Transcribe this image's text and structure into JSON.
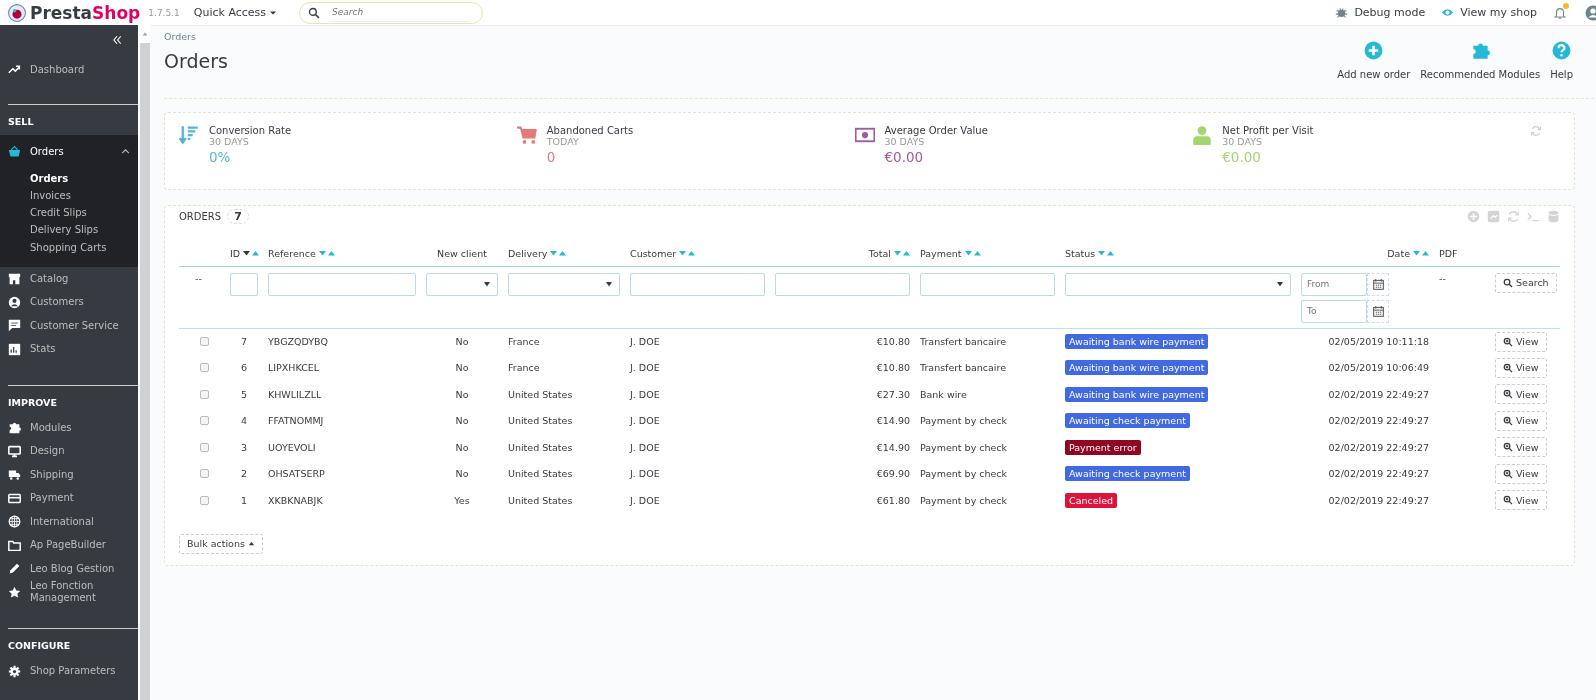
{
  "header": {
    "brand": "PrestaShop",
    "version": "1.7.5.1",
    "quick_access": "Quick Access",
    "search": {
      "placeholder": "Search"
    },
    "links": [
      {
        "label": "Debug mode"
      },
      {
        "label": "View my shop"
      }
    ],
    "notifications": {
      "unread": true
    }
  },
  "sidebar": {
    "sections": [
      {
        "items": [
          {
            "label": "Dashboard",
            "expanded": false
          }
        ]
      },
      {
        "title": "SELL",
        "items": [
          {
            "label": "Orders",
            "expanded": true,
            "children": [
              {
                "label": "Orders",
                "selected": true
              },
              {
                "label": "Invoices",
                "selected": false
              },
              {
                "label": "Credit Slips",
                "selected": false
              },
              {
                "label": "Delivery Slips",
                "selected": false
              },
              {
                "label": "Shopping Carts",
                "selected": false
              }
            ]
          },
          {
            "label": "Catalog",
            "expanded": false
          },
          {
            "label": "Customers",
            "expanded": false
          },
          {
            "label": "Customer Service",
            "expanded": false
          },
          {
            "label": "Stats",
            "expanded": false
          }
        ]
      },
      {
        "title": "IMPROVE",
        "items": [
          {
            "label": "Modules",
            "expanded": false
          },
          {
            "label": "Design",
            "expanded": false
          },
          {
            "label": "Shipping",
            "expanded": false
          },
          {
            "label": "Payment",
            "expanded": false
          },
          {
            "label": "International",
            "expanded": false
          },
          {
            "label": "Ap PageBuilder",
            "expanded": false
          },
          {
            "label": "Leo Blog Gestion",
            "expanded": false
          },
          {
            "label": "Leo Fonction Management",
            "expanded": false
          }
        ]
      },
      {
        "title": "CONFIGURE",
        "items": [
          {
            "label": "Shop Parameters",
            "expanded": false
          }
        ]
      }
    ]
  },
  "breadcrumb": "Orders",
  "title": "Orders",
  "toolbar": [
    {
      "label": "Add new order"
    },
    {
      "label": "Recommended Modules"
    },
    {
      "label": "Help"
    }
  ],
  "kpis": [
    {
      "label": "Conversion Rate",
      "period": "30 DAYS",
      "value": "0%",
      "color": "#56b3d8"
    },
    {
      "label": "Abandoned Carts",
      "period": "TODAY",
      "value": "0",
      "color": "#e27c79"
    },
    {
      "label": "Average Order Value",
      "period": "30 DAYS",
      "value": "€0.00",
      "color": "#9e5ba1"
    },
    {
      "label": "Net Profit per Visit",
      "period": "30 DAYS",
      "value": "€0.00",
      "color": "#a3d76e"
    }
  ],
  "orders": {
    "title": "ORDERS",
    "count": "7",
    "columns": [
      {
        "label": "ID",
        "sortable": true
      },
      {
        "label": "Reference",
        "sortable": true
      },
      {
        "label": "New client",
        "sortable": false
      },
      {
        "label": "Delivery",
        "sortable": true
      },
      {
        "label": "Customer",
        "sortable": true
      },
      {
        "label": "Total",
        "sortable": true
      },
      {
        "label": "Payment",
        "sortable": true
      },
      {
        "label": "Status",
        "sortable": true
      },
      {
        "label": "Date",
        "sortable": true
      },
      {
        "label": "PDF",
        "sortable": false
      }
    ],
    "filters": {
      "reset": "--",
      "pdf": "--",
      "date_from": {
        "placeholder": "From"
      },
      "date_to": {
        "placeholder": "To"
      },
      "search_button": "Search"
    },
    "rows": [
      {
        "selected": false,
        "id": "7",
        "reference": "YBGZQDYBQ",
        "new_client": "No",
        "delivery": "France",
        "customer": "J. DOE",
        "total": "€10.80",
        "payment": "Transfert bancaire",
        "status": "Awaiting bank wire payment",
        "color": "#4169e1",
        "date": "02/05/2019 10:11:18",
        "action": "View"
      },
      {
        "selected": false,
        "id": "6",
        "reference": "LIPXHKCEL",
        "new_client": "No",
        "delivery": "France",
        "customer": "J. DOE",
        "total": "€10.80",
        "payment": "Transfert bancaire",
        "status": "Awaiting bank wire payment",
        "color": "#4169e1",
        "date": "02/05/2019 10:06:49",
        "action": "View"
      },
      {
        "selected": false,
        "id": "5",
        "reference": "KHWLILZLL",
        "new_client": "No",
        "delivery": "United States",
        "customer": "J. DOE",
        "total": "€27.30",
        "payment": "Bank wire",
        "status": "Awaiting bank wire payment",
        "color": "#4169e1",
        "date": "02/02/2019 22:49:27",
        "action": "View"
      },
      {
        "selected": false,
        "id": "4",
        "reference": "FFATNOMMJ",
        "new_client": "No",
        "delivery": "United States",
        "customer": "J. DOE",
        "total": "€14.90",
        "payment": "Payment by check",
        "status": "Awaiting check payment",
        "color": "#4169e1",
        "date": "02/02/2019 22:49:27",
        "action": "View"
      },
      {
        "selected": false,
        "id": "3",
        "reference": "UOYEVOLI",
        "new_client": "No",
        "delivery": "United States",
        "customer": "J. DOE",
        "total": "€14.90",
        "payment": "Payment by check",
        "status": "Payment error",
        "color": "#8f0621",
        "date": "02/02/2019 22:49:27",
        "action": "View"
      },
      {
        "selected": false,
        "id": "2",
        "reference": "OHSATSERP",
        "new_client": "No",
        "delivery": "United States",
        "customer": "J. DOE",
        "total": "€69.90",
        "payment": "Payment by check",
        "status": "Awaiting check payment",
        "color": "#4169e1",
        "date": "02/02/2019 22:49:27",
        "action": "View"
      },
      {
        "selected": false,
        "id": "1",
        "reference": "XKBKNABJK",
        "new_client": "Yes",
        "delivery": "United States",
        "customer": "J. DOE",
        "total": "€61.80",
        "payment": "Payment by check",
        "status": "Canceled",
        "color": "#dc143c",
        "date": "02/02/2019 22:49:27",
        "action": "View"
      }
    ],
    "bulk_actions": "Bulk actions"
  }
}
